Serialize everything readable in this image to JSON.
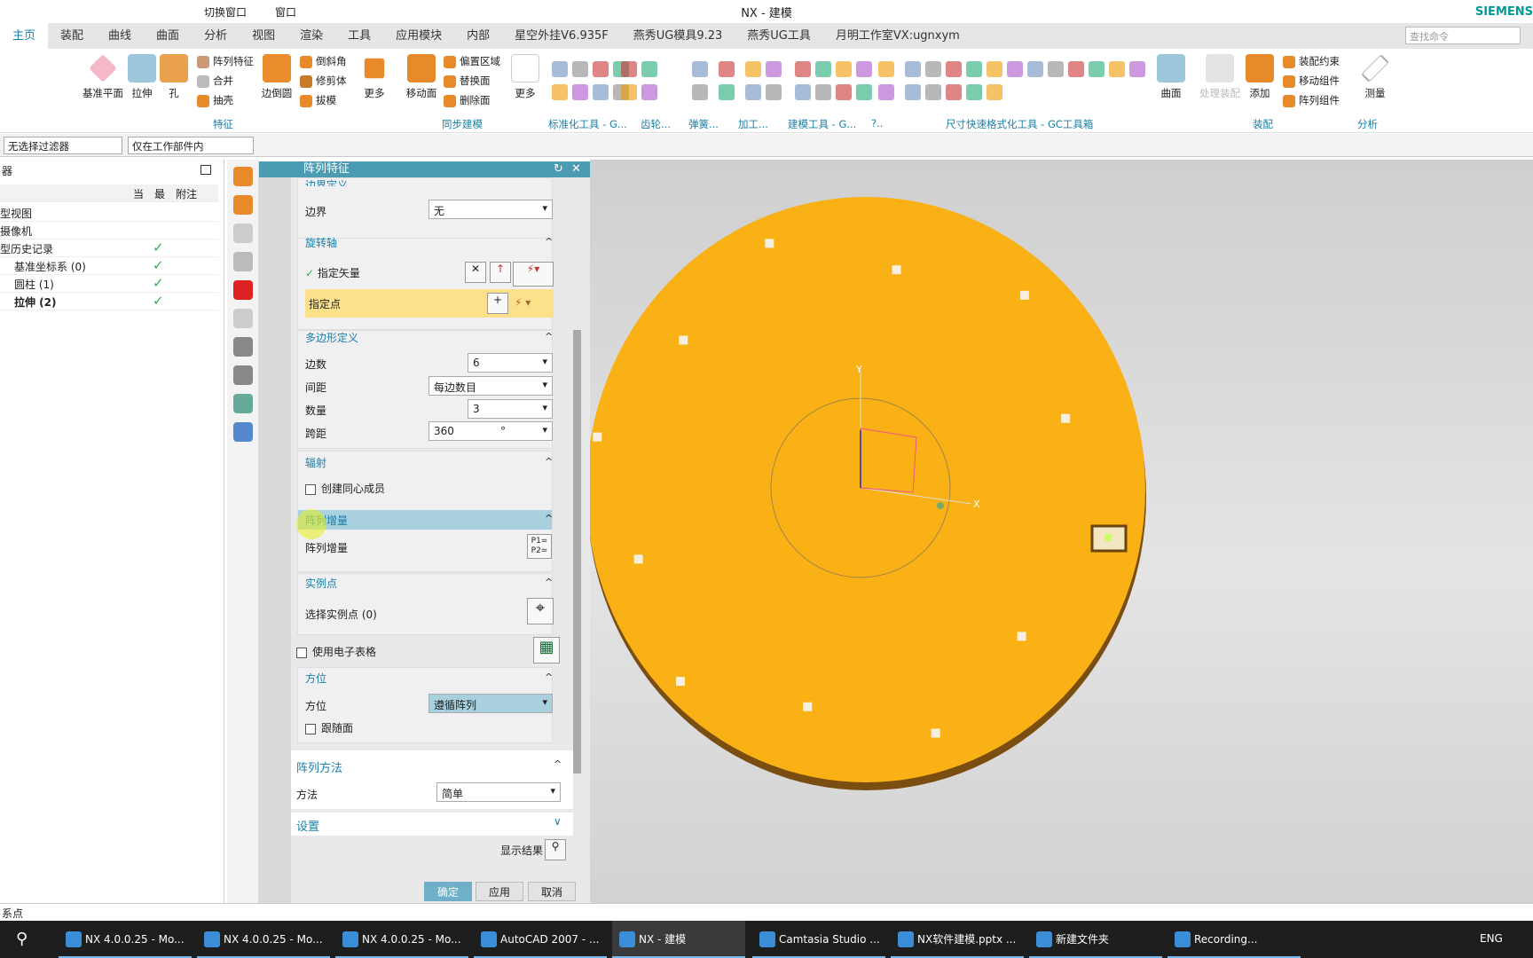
{
  "window": {
    "title": "NX - 建模",
    "brand": "SIEMENS"
  },
  "quick_access": {
    "switch_window": "切换窗口",
    "window": "窗口"
  },
  "tabs": [
    "主页",
    "装配",
    "曲线",
    "曲面",
    "分析",
    "视图",
    "渲染",
    "工具",
    "应用模块",
    "内部",
    "星空外挂V6.935F",
    "燕秀UG模具9.23",
    "燕秀UG工具",
    "月明工作室VX:ugnxym"
  ],
  "search_placeholder": "查找命令",
  "ribbon": {
    "datum_plane": "基准平面",
    "extrude": "拉伸",
    "hole": "孔",
    "pattern_feature": "阵列特征",
    "unite": "合并",
    "shell": "抽壳",
    "edge_blend": "边倒圆",
    "chamfer": "倒斜角",
    "trim_body": "修剪体",
    "draft": "拔模",
    "more1": "更多",
    "move_face": "移动面",
    "offset_region": "偏置区域",
    "replace_face": "替换面",
    "delete_face": "删除面",
    "more2": "更多",
    "surface": "曲面",
    "handle_assembly": "处理装配",
    "add": "添加",
    "assembly_constraint": "装配约束",
    "move_component": "移动组件",
    "pattern_component": "阵列组件",
    "measure": "测量",
    "groups": {
      "feature": "特征",
      "sync": "同步建模",
      "std": "标准化工具 - G...",
      "gear": "齿轮...",
      "spring": "弹簧...",
      "machining": "加工...",
      "modeling": "建模工具 - G...",
      "more": "?..",
      "dim": "尺寸快速格式化工具 - GC工具箱",
      "assembly": "装配",
      "analysis": "分析"
    }
  },
  "selection": {
    "filter": "无选择过滤器",
    "scope": "仅在工作部件内"
  },
  "navigator": {
    "title": "器",
    "col_current": "当",
    "col_latest": "最",
    "col_notes": "附注",
    "rows": [
      "型视图",
      "摄像机",
      "型历史记录",
      "基准坐标系 (0)",
      "圆柱 (1)",
      "拉伸 (2)"
    ]
  },
  "dialog": {
    "title": "阵列特征",
    "boundary_section": "边界定义",
    "boundary_label": "边界",
    "boundary_value": "无",
    "axis_section": "旋转轴",
    "specify_vector": "指定矢量",
    "specify_point": "指定点",
    "polygon_section": "多边形定义",
    "sides_label": "边数",
    "sides_value": "6",
    "spacing_label": "间距",
    "spacing_value": "每边数目",
    "count_label": "数量",
    "count_value": "3",
    "span_label": "跨距",
    "span_value": "360",
    "span_unit": "°",
    "radiate_section": "辐射",
    "concentric": "创建同心成员",
    "increment_section": "阵列增量",
    "increment_label": "阵列增量",
    "increment_icon": "P1=\nP2=",
    "instance_section": "实例点",
    "select_instance": "选择实例点 (0)",
    "spreadsheet": "使用电子表格",
    "orientation_section": "方位",
    "orientation_label": "方位",
    "orientation_value": "遵循阵列",
    "follow_face": "跟随面",
    "method_section": "阵列方法",
    "method_label": "方法",
    "method_value": "简单",
    "settings_section": "设置",
    "show_result": "显示结果",
    "ok": "确定",
    "apply": "应用",
    "cancel": "取消"
  },
  "viewport": {
    "axis_y": "Y",
    "axis_x": "X",
    "disc_color": "#f9b115",
    "rim_color": "#7a4d10"
  },
  "status": "系点",
  "taskbar": {
    "items": [
      "NX 4.0.0.25 - Mo...",
      "NX 4.0.0.25 - Mo...",
      "NX 4.0.0.25 - Mo...",
      "AutoCAD 2007 - ...",
      "NX - 建模",
      "Camtasia Studio ...",
      "NX软件建模.pptx ...",
      "新建文件夹",
      "Recording..."
    ],
    "lang": "ENG"
  }
}
